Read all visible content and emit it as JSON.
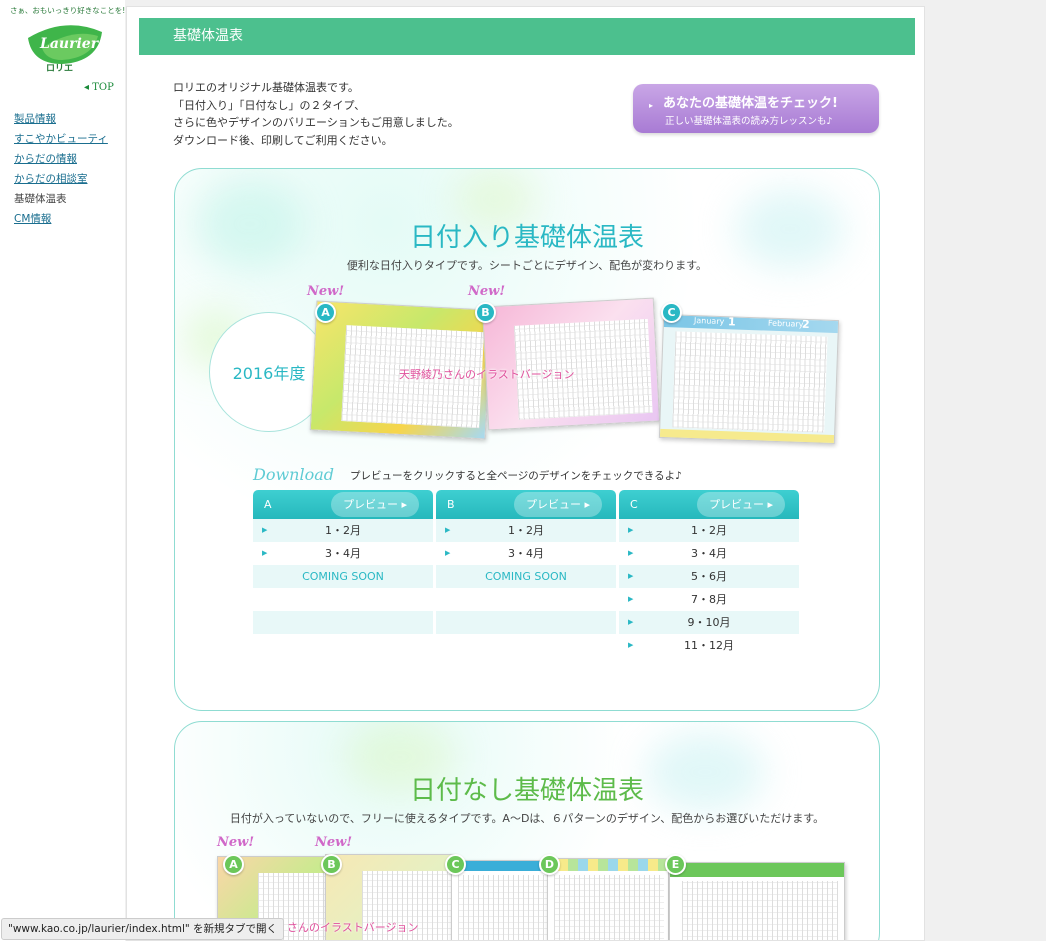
{
  "sidebar": {
    "tagline": "さぁ、おもいっきり好きなことを!",
    "logo_text": "ロリエ",
    "logo_script": "Laurier",
    "top_link": "◂ TOP",
    "nav": [
      {
        "label": "製品情報",
        "link": true
      },
      {
        "label": "すこやかビューティ",
        "link": true
      },
      {
        "label": "からだの情報",
        "link": true
      },
      {
        "label": "からだの相談室",
        "link": true
      },
      {
        "label": "基礎体温表",
        "link": false
      },
      {
        "label": "CM情報",
        "link": true
      }
    ]
  },
  "header": {
    "title": "基礎体温表"
  },
  "intro": [
    "ロリエのオリジナル基礎体温表です。",
    "「日付入り」「日付なし」の２タイプ、",
    "さらに色やデザインのバリエーションもご用意しました。",
    "ダウンロード後、印刷してご利用ください。"
  ],
  "check_button": {
    "line1": "あなたの基礎体温をチェック!",
    "line2": "正しい基礎体温表の読み方レッスンも♪",
    "arrow": "▸"
  },
  "dated": {
    "title": "日付入り基礎体温表",
    "subtitle": "便利な日付入りタイプです。シートごとにデザイン、配色が変わります。",
    "year": "2016年度",
    "new_label": "New!",
    "illust_label": "天野綾乃さんのイラストバージョン",
    "sheet_c_labels": {
      "jan": "January",
      "jan_num": "1",
      "feb": "February",
      "feb_num": "2"
    },
    "download_title": "Download",
    "download_note": "プレビューをクリックすると全ページのデザインをチェックできるよ♪",
    "preview_label": "プレビュー ▸",
    "columns": [
      {
        "letter": "A",
        "rows": [
          "1・2月",
          "3・4月",
          "COMING SOON",
          "",
          "",
          ""
        ]
      },
      {
        "letter": "B",
        "rows": [
          "1・2月",
          "3・4月",
          "COMING SOON",
          "",
          "",
          ""
        ]
      },
      {
        "letter": "C",
        "rows": [
          "1・2月",
          "3・4月",
          "5・6月",
          "7・8月",
          "9・10月",
          "11・12月"
        ]
      }
    ]
  },
  "undated": {
    "title": "日付なし基礎体温表",
    "subtitle": "日付が入っていないので、フリーに使えるタイプです。A〜Dは、６パターンのデザイン、配色からお選びいただけます。",
    "new_label": "New!",
    "illust_label": "さんのイラストバージョン",
    "letters": [
      "A",
      "B",
      "C",
      "D",
      "E"
    ]
  },
  "status_bar": "\"www.kao.co.jp/laurier/index.html\" を新規タブで開く",
  "colors": {
    "header_green": "#4cc08e",
    "teal": "#2ab8c4",
    "green_title": "#5dbb4a",
    "purple_btn": "#b58ddc",
    "new_pink": "#d068c8"
  }
}
